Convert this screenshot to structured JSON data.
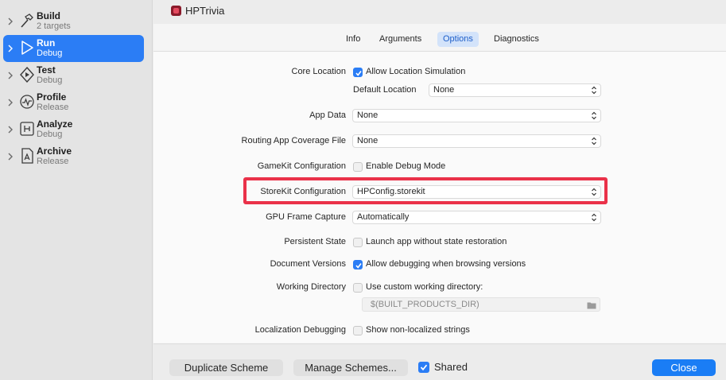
{
  "sidebar": {
    "items": [
      {
        "title": "Build",
        "subtitle": "2 targets",
        "icon": "hammer-icon"
      },
      {
        "title": "Run",
        "subtitle": "Debug",
        "icon": "play-icon"
      },
      {
        "title": "Test",
        "subtitle": "Debug",
        "icon": "test-diamond-icon"
      },
      {
        "title": "Profile",
        "subtitle": "Release",
        "icon": "profile-waveform-icon"
      },
      {
        "title": "Analyze",
        "subtitle": "Debug",
        "icon": "analyze-icon"
      },
      {
        "title": "Archive",
        "subtitle": "Release",
        "icon": "archive-icon"
      }
    ]
  },
  "header": {
    "app_name": "HPTrivia"
  },
  "tabs": [
    {
      "label": "Info"
    },
    {
      "label": "Arguments"
    },
    {
      "label": "Options"
    },
    {
      "label": "Diagnostics"
    }
  ],
  "options": {
    "core_location": {
      "label": "Core Location",
      "checkbox_label": "Allow Location Simulation",
      "checked": true
    },
    "default_location": {
      "label": "Default Location",
      "value": "None"
    },
    "app_data": {
      "label": "App Data",
      "value": "None"
    },
    "routing_coverage": {
      "label": "Routing App Coverage File",
      "value": "None"
    },
    "gamekit": {
      "label": "GameKit Configuration",
      "checkbox_label": "Enable Debug Mode",
      "checked": false
    },
    "storekit": {
      "label": "StoreKit Configuration",
      "value": "HPConfig.storekit"
    },
    "gpu_capture": {
      "label": "GPU Frame Capture",
      "value": "Automatically"
    },
    "persistent_state": {
      "label": "Persistent State",
      "checkbox_label": "Launch app without state restoration",
      "checked": false
    },
    "document_versions": {
      "label": "Document Versions",
      "checkbox_label": "Allow debugging when browsing versions",
      "checked": true
    },
    "working_directory": {
      "label": "Working Directory",
      "checkbox_label": "Use custom working directory:",
      "checked": false,
      "path": "$(BUILT_PRODUCTS_DIR)"
    },
    "localization": {
      "label": "Localization Debugging",
      "checkbox_label": "Show non-localized strings",
      "checked": false
    }
  },
  "footer": {
    "duplicate_label": "Duplicate Scheme",
    "manage_label": "Manage Schemes...",
    "shared_label": "Shared",
    "shared_checked": true,
    "close_label": "Close"
  },
  "colors": {
    "accent": "#2b7df5",
    "highlight": "#ea3149"
  }
}
